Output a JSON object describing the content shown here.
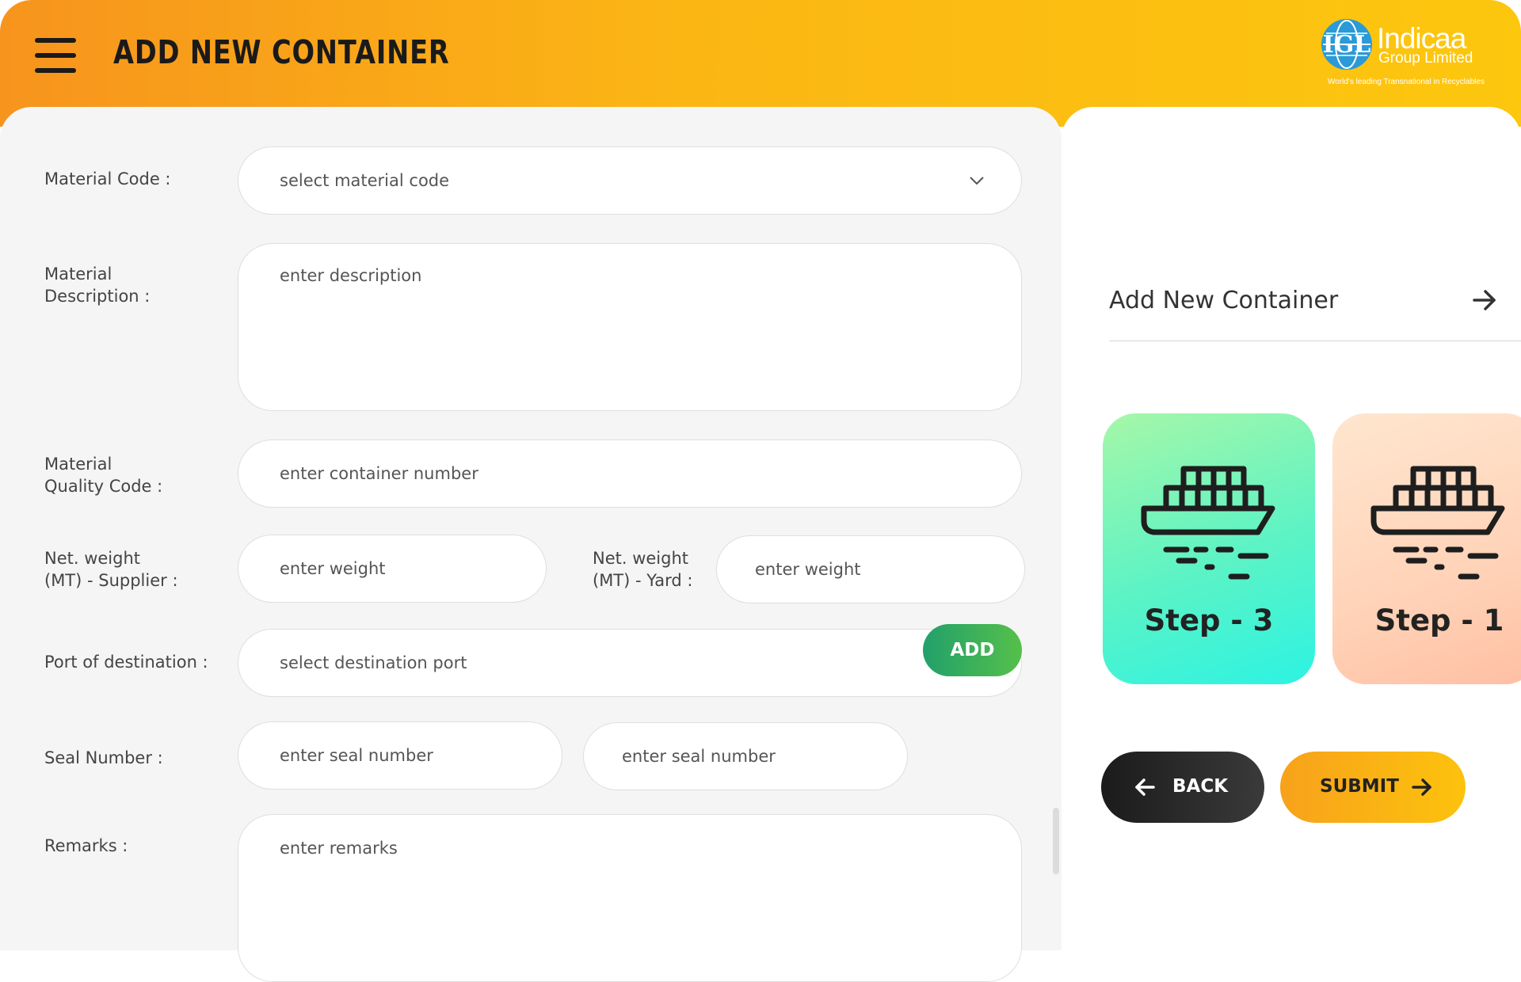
{
  "header": {
    "title": "ADD NEW CONTAINER",
    "logo": {
      "mark": "IGL",
      "name": "Indicaa",
      "subtitle": "Group Limited",
      "tagline": "World's leading Transnational in Recyclables"
    },
    "menu_icon": "hamburger-menu-icon"
  },
  "form": {
    "material_code": {
      "label": "Material Code :",
      "placeholder": "select material code"
    },
    "material_description": {
      "label": "Material\nDescription :",
      "placeholder": "enter description"
    },
    "quality_code": {
      "label": "Material\nQuality Code   :",
      "placeholder": "enter container number"
    },
    "weight_supplier": {
      "label": "Net. weight\n(MT) - Supplier  :",
      "placeholder": "enter weight"
    },
    "weight_yard": {
      "label": "Net. weight\n(MT) - Yard :",
      "placeholder": "enter weight"
    },
    "port": {
      "label": "Port of destination  :",
      "placeholder": "select destination port"
    },
    "seal": {
      "label": "Seal Number :",
      "placeholder_1": "enter seal number",
      "placeholder_2": "enter seal number",
      "add_label": "ADD"
    },
    "remarks": {
      "label": "Remarks :",
      "placeholder": "enter remarks"
    }
  },
  "sidebar": {
    "section_title": "Add New Container",
    "steps": [
      {
        "label": "Step - 3",
        "icon": "cargo-ship-icon"
      },
      {
        "label": "Step - 1",
        "icon": "cargo-ship-icon"
      }
    ],
    "back_label": "BACK",
    "submit_label": "SUBMIT"
  },
  "colors": {
    "header_start": "#f7941d",
    "header_end": "#fdc70e",
    "add_button": "#22a06b",
    "step3_card": "#5cf3c5",
    "step1_card": "#ffd3b8",
    "back_button": "#1b1b1b",
    "submit_button": "#fbb614"
  }
}
